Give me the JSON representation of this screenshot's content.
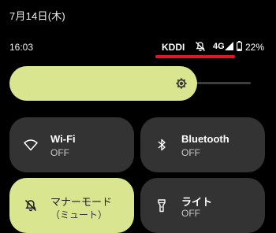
{
  "header": {
    "date": "7月14日(木)"
  },
  "status_bar": {
    "time": "16:03",
    "carrier": "KDDI",
    "network_type": "4G",
    "battery": "22%",
    "icons": [
      "mute-icon",
      "signal-icon",
      "battery-icon"
    ]
  },
  "brightness": {
    "icon": "sun-icon",
    "level": 0.75
  },
  "tiles": [
    {
      "title": "Wi-Fi",
      "state": "OFF",
      "icon": "wifi-icon",
      "active": false
    },
    {
      "title": "Bluetooth",
      "state": "OFF",
      "icon": "bluetooth-icon",
      "active": false
    },
    {
      "title": "マナーモード",
      "state": "（ミュート）",
      "icon": "mute-icon",
      "active": true
    },
    {
      "title": "ライト",
      "state": "OFF",
      "icon": "flashlight-icon",
      "active": false
    }
  ],
  "colors": {
    "accent": "#d9e68f",
    "tile_background": "#333333",
    "highlight": "#e8102a"
  }
}
